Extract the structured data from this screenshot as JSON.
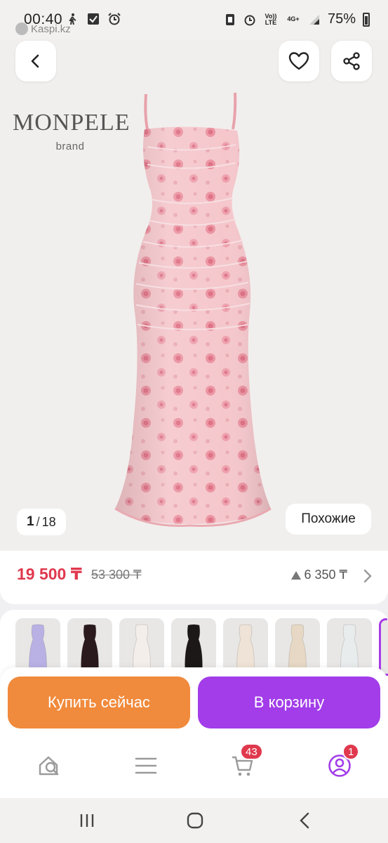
{
  "status_bar": {
    "time": "00:40",
    "app_label": "Kaspi.kz",
    "network_label_top": "Vo)) LTE",
    "network_label_4g": "4G+",
    "battery": "75%"
  },
  "product": {
    "brand_name": "MONPELE",
    "brand_sub": "brand",
    "image_counter": {
      "current": "1",
      "separator": "/",
      "total": "18"
    },
    "similar_label": "Похожие",
    "price": "19 500 ₸",
    "old_price": "53 300 ₸",
    "bonus": "6 350 ₸"
  },
  "thumbnails": [
    {
      "name": "thumb-lavender-dress",
      "color": "#b9b1e4"
    },
    {
      "name": "thumb-black-floral-dress",
      "color": "#2a1a1e"
    },
    {
      "name": "thumb-white-cherry-dress",
      "color": "#f4eeea"
    },
    {
      "name": "thumb-black-dress-model",
      "color": "#1c1818"
    },
    {
      "name": "thumb-cream-dress",
      "color": "#eee3d6"
    },
    {
      "name": "thumb-beige-dress",
      "color": "#e6d8c4"
    },
    {
      "name": "thumb-white-print-dress",
      "color": "#e8ecec"
    },
    {
      "name": "thumb-pink-dress-selected",
      "color": "#f3cfd2"
    }
  ],
  "actions": {
    "buy_now": "Купить сейчас",
    "add_to_cart": "В корзину"
  },
  "bottom_nav": {
    "cart_badge": "43",
    "profile_badge": "1"
  },
  "colors": {
    "price_red": "#e0384d",
    "buy_orange": "#f08a3c",
    "cart_purple": "#a23de9"
  }
}
